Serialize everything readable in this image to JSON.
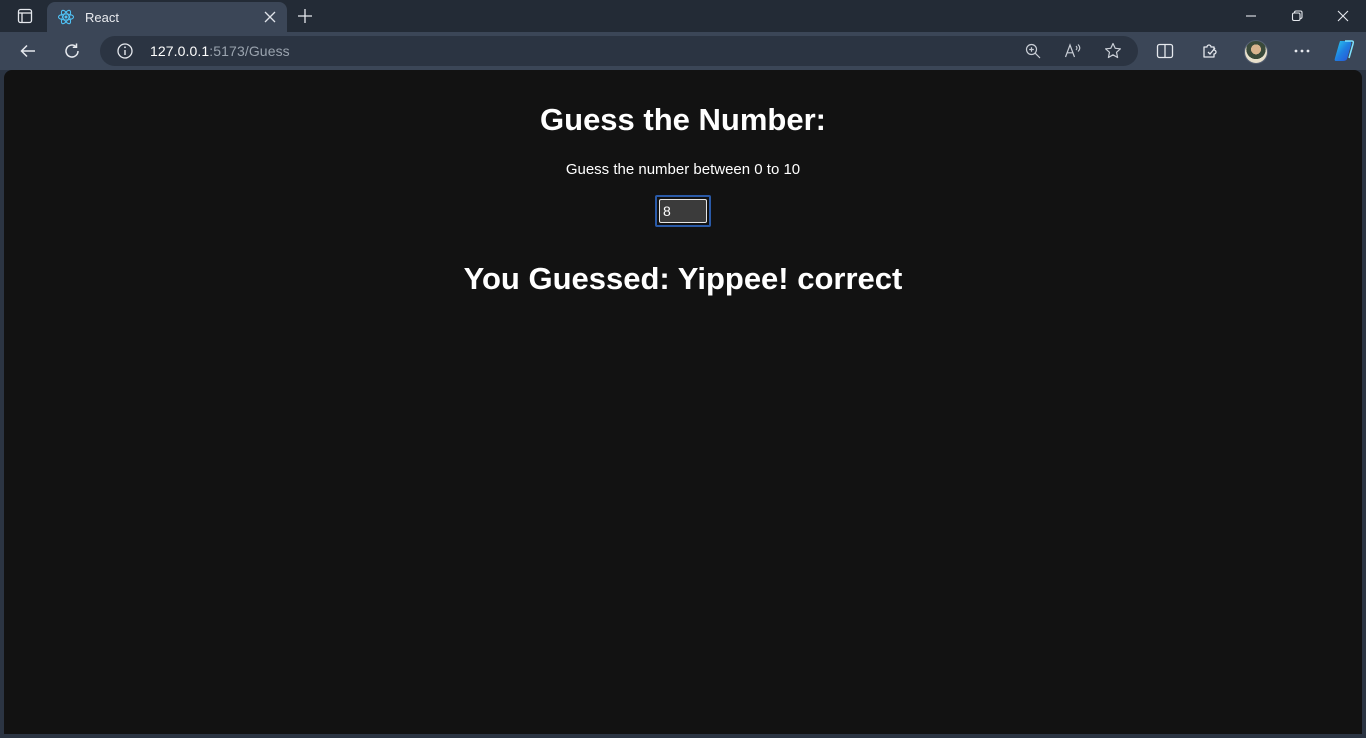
{
  "browser": {
    "tab": {
      "title": "React",
      "favicon": "react-icon"
    },
    "address": {
      "host": "127.0.0.1",
      "rest": ":5173/Guess"
    },
    "icons": {
      "tab_actions": "tab-actions-icon",
      "new_tab": "plus-icon",
      "back": "back-arrow-icon",
      "refresh": "refresh-icon",
      "info": "info-icon",
      "zoom": "zoom-in-icon",
      "read_aloud": "read-aloud-icon",
      "favorite": "star-icon",
      "split": "split-screen-icon",
      "extensions": "extensions-icon",
      "profile": "avatar",
      "more": "more-icon",
      "copilot": "copilot-icon"
    },
    "colors": {
      "frame": "#232b36",
      "toolbar": "#3b4657",
      "page_bg": "#121212",
      "accent": "#2a5aa8"
    }
  },
  "page": {
    "title": "Guess the Number:",
    "prompt": "Guess the number between 0 to 10",
    "guess_value": "8",
    "result": "You Guessed: Yippee! correct"
  }
}
